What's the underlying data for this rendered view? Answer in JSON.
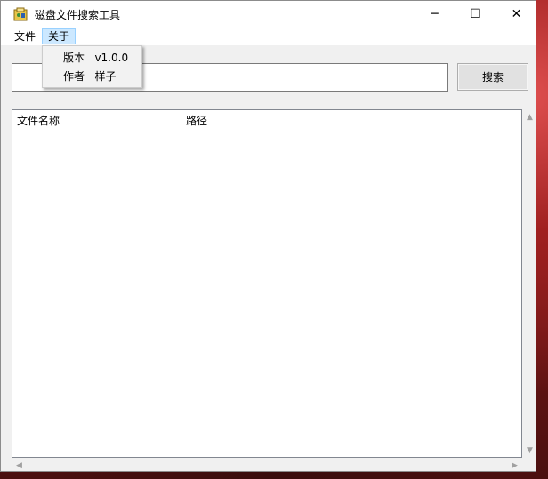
{
  "window": {
    "title": "磁盘文件搜索工具",
    "minimize_glyph": "─",
    "maximize_glyph": "☐",
    "close_glyph": "✕"
  },
  "menu": {
    "items": [
      {
        "label": "文件"
      },
      {
        "label": "关于"
      }
    ],
    "about_dropdown": [
      {
        "label": "版本   v1.0.0"
      },
      {
        "label": "作者   样子"
      }
    ]
  },
  "search": {
    "value": "",
    "placeholder": "",
    "button_label": "搜索"
  },
  "results": {
    "columns": [
      {
        "label": "文件名称"
      },
      {
        "label": "路径"
      }
    ],
    "rows": []
  },
  "scrollbars": {
    "up": "▲",
    "down": "▼",
    "left": "◀",
    "right": "▶"
  },
  "colors": {
    "menu_active_bg": "#cce8ff",
    "window_bg": "#f0f0f0"
  }
}
